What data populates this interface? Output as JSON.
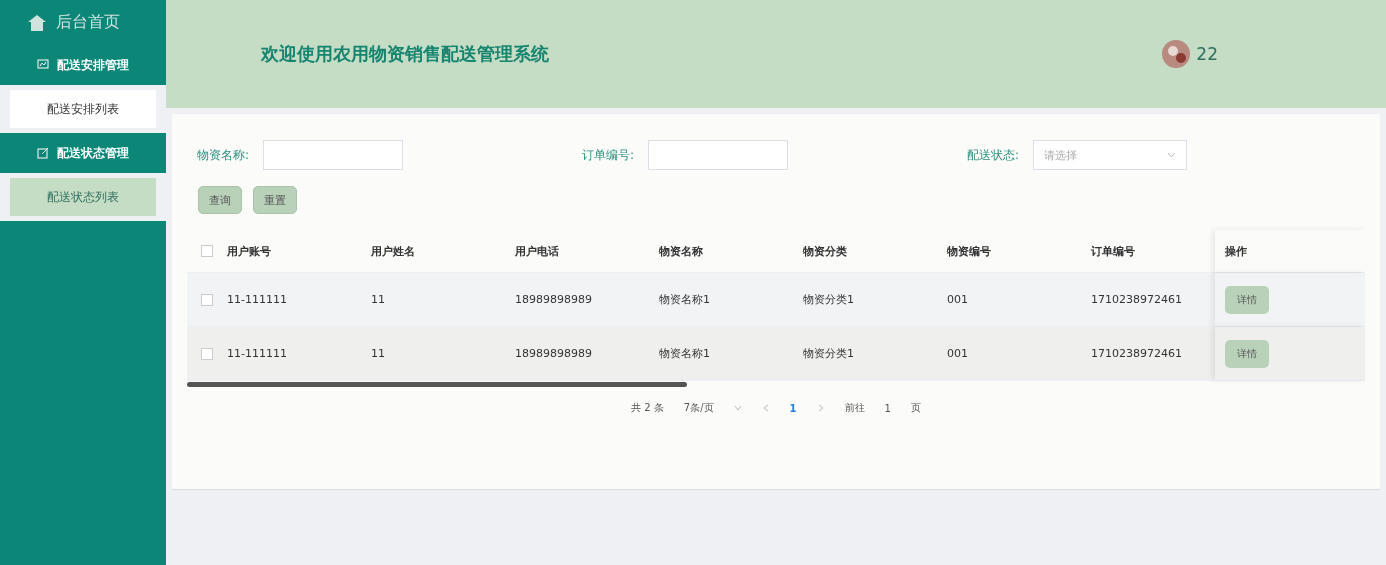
{
  "sidebar": {
    "home": "后台首页",
    "groups": [
      {
        "title": "配送安排管理",
        "items": [
          {
            "label": "配送安排列表",
            "selected": false
          }
        ]
      },
      {
        "title": "配送状态管理",
        "items": [
          {
            "label": "配送状态列表",
            "selected": true
          }
        ]
      }
    ]
  },
  "header": {
    "title": "欢迎使用农用物资销售配送管理系统",
    "user": "22"
  },
  "filters": [
    {
      "label": "物资名称:",
      "kind": "input"
    },
    {
      "label": "订单编号:",
      "kind": "input"
    },
    {
      "label": "配送状态:",
      "kind": "select",
      "placeholder": "请选择"
    }
  ],
  "buttons": [
    "查询",
    "重置"
  ],
  "table": {
    "columns": [
      "用户账号",
      "用户姓名",
      "用户电话",
      "物资名称",
      "物资分类",
      "物资编号",
      "订单编号"
    ],
    "action_column": "操作",
    "all_checked": false,
    "rows": [
      {
        "cells": [
          "11-111111",
          "11",
          "18989898989",
          "物资名称1",
          "物资分类1",
          "001",
          "1710238972461"
        ],
        "checked": false,
        "action": "详情"
      },
      {
        "cells": [
          "11-111111",
          "11",
          "18989898989",
          "物资名称1",
          "物资分类1",
          "001",
          "1710238972461"
        ],
        "checked": false,
        "action": "详情"
      }
    ]
  },
  "pagination": {
    "total": "共 2 条",
    "page_size": "7条/页",
    "pages": [
      {
        "label": "1",
        "selected": true
      }
    ],
    "goto": "前往",
    "goto_value": "1",
    "goto_suffix": "页"
  }
}
